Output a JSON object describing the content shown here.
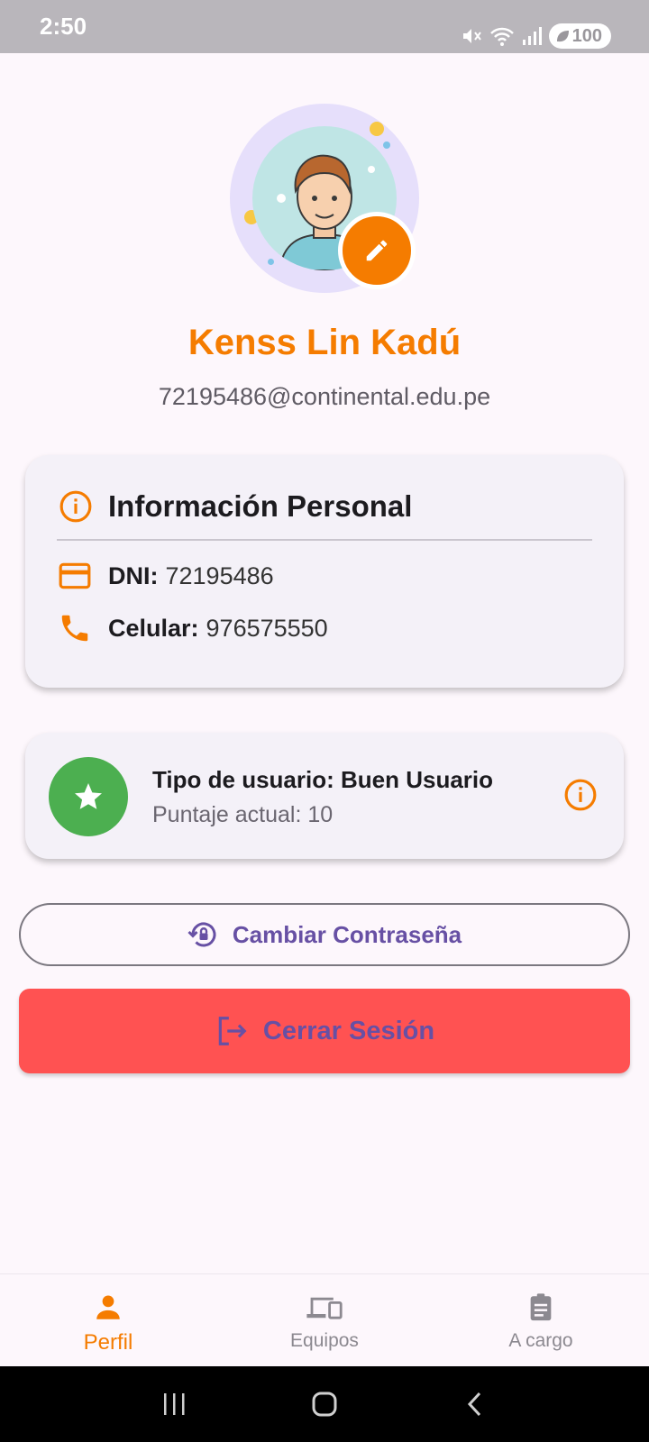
{
  "status_bar": {
    "time": "2:50",
    "battery": "100"
  },
  "profile": {
    "name": "Kenss Lin Kadú",
    "email": "72195486@continental.edu.pe"
  },
  "personal_info": {
    "title": "Información Personal",
    "dni_label": "DNI:",
    "dni_value": "72195486",
    "phone_label": "Celular:",
    "phone_value": "976575550"
  },
  "user_type": {
    "title": "Tipo de usuario: Buen Usuario",
    "score": "Puntaje actual: 10"
  },
  "actions": {
    "change_password": "Cambiar Contraseña",
    "logout": "Cerrar Sesión"
  },
  "bottom_nav": {
    "items": [
      {
        "label": "Perfil",
        "icon": "person-icon",
        "active": true
      },
      {
        "label": "Equipos",
        "icon": "devices-icon",
        "active": false
      },
      {
        "label": "A cargo",
        "icon": "clipboard-icon",
        "active": false
      }
    ]
  },
  "colors": {
    "accent": "#f57c00",
    "primary": "#6750a4",
    "success": "#4caf50",
    "danger": "#ff5252",
    "background": "#fdf7fc"
  }
}
